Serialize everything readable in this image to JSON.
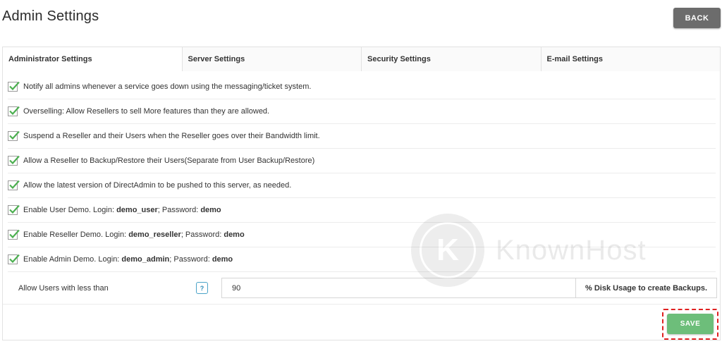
{
  "header": {
    "title": "Admin Settings",
    "back_label": "BACK"
  },
  "tabs": [
    {
      "label": "Administrator Settings",
      "active": true
    },
    {
      "label": "Server Settings",
      "active": false
    },
    {
      "label": "Security Settings",
      "active": false
    },
    {
      "label": "E-mail Settings",
      "active": false
    }
  ],
  "options": [
    {
      "text": "Notify all admins whenever a service goes down using the messaging/ticket system.",
      "checked": true
    },
    {
      "text": "Overselling: Allow Resellers to sell More features than they are allowed.",
      "checked": true
    },
    {
      "text": "Suspend a Reseller and their Users when the Reseller goes over their Bandwidth limit.",
      "checked": true
    },
    {
      "text": "Allow a Reseller to Backup/Restore their Users(Separate from User Backup/Restore)",
      "checked": true
    },
    {
      "text": "Allow the latest version of DirectAdmin to be pushed to this server, as needed.",
      "checked": true
    },
    {
      "prefix": "Enable User Demo. Login: ",
      "login": "demo_user",
      "middle": "; Password: ",
      "password": "demo",
      "checked": true
    },
    {
      "prefix": "Enable Reseller Demo. Login: ",
      "login": "demo_reseller",
      "middle": "; Password: ",
      "password": "demo",
      "checked": true
    },
    {
      "prefix": "Enable Admin Demo. Login: ",
      "login": "demo_admin",
      "middle": "; Password: ",
      "password": "demo",
      "checked": true
    }
  ],
  "backup": {
    "label": "Allow Users with less than",
    "help_icon": "question-icon",
    "help_symbol": "?",
    "value": "90",
    "suffix": "% Disk Usage to create Backups."
  },
  "footer": {
    "save_label": "SAVE"
  },
  "watermark": {
    "logo_letter": "K",
    "text": "KnownHost"
  },
  "colors": {
    "back_button": "#6c6c6c",
    "save_button": "#6dbe7a",
    "check_mark": "#4caf50",
    "highlight": "#e02020",
    "help_icon": "#4aa3c8"
  }
}
